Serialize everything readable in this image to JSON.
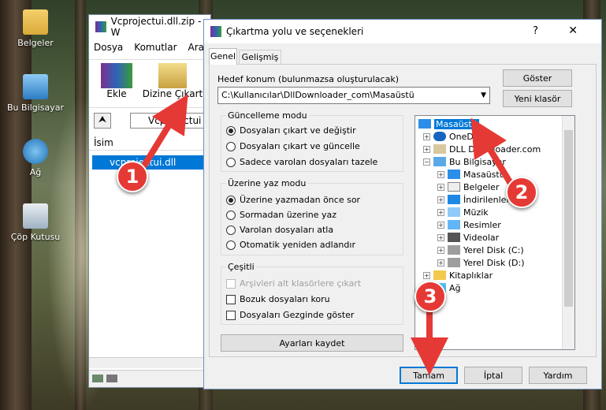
{
  "desktop": {
    "icons": [
      {
        "label": "Belgeler"
      },
      {
        "label": "Bu Bilgisayar"
      },
      {
        "label": "Ağ"
      },
      {
        "label": "Çöp Kutusu"
      }
    ]
  },
  "back_window": {
    "title": "Vcprojectui.dll.zip - W",
    "menu": [
      "Dosya",
      "Komutlar",
      "Araçla"
    ],
    "toolbar": [
      "Ekle",
      "Dizine Çıkart"
    ],
    "path": "Vcprojectui",
    "column": "İsim",
    "file": "vcprojectui.dll"
  },
  "dialog": {
    "title": "Çıkartma yolu ve seçenekleri",
    "help": "?",
    "close": "✕",
    "tabs": [
      "Genel",
      "Gelişmiş"
    ],
    "dest_label": "Hedef konum (bulunmazsa oluşturulacak)",
    "dest_value": "C:\\Kullanıcılar\\DllDownloader_com\\Masaüstü",
    "show_btn": "Göster",
    "new_folder_btn": "Yeni klasör",
    "update_group": "Güncelleme modu",
    "update_opts": [
      "Dosyaları çıkart ve değiştir",
      "Dosyaları çıkart ve güncelle",
      "Sadece varolan dosyaları tazele"
    ],
    "overwrite_group": "Üzerine yaz modu",
    "overwrite_opts": [
      "Üzerine yazmadan önce sor",
      "Sormadan üzerine yaz",
      "Varolan dosyaları atla",
      "Otomatik yeniden adlandır"
    ],
    "misc_group": "Çeşitli",
    "misc_opts": [
      "Arşivleri alt klasörlere çıkart",
      "Bozuk dosyaları koru",
      "Dosyaları Gezginde göster"
    ],
    "save_btn": "Ayarları kaydet",
    "tree": [
      "Masaüstü",
      "OneDrive",
      "DLL Downloader.com",
      "Bu Bilgisayar",
      "Masaüstü",
      "Belgeler",
      "İndirilenler",
      "Müzik",
      "Resimler",
      "Videolar",
      "Yerel Disk (C:)",
      "Yerel Disk (D:)",
      "Kitaplıklar",
      "Ağ"
    ],
    "ok": "Tamam",
    "cancel": "İptal",
    "help_btn": "Yardım"
  },
  "markers": [
    "1",
    "2",
    "3"
  ],
  "colors": {
    "selection": "#0078d7",
    "arrow": "#e53935"
  }
}
